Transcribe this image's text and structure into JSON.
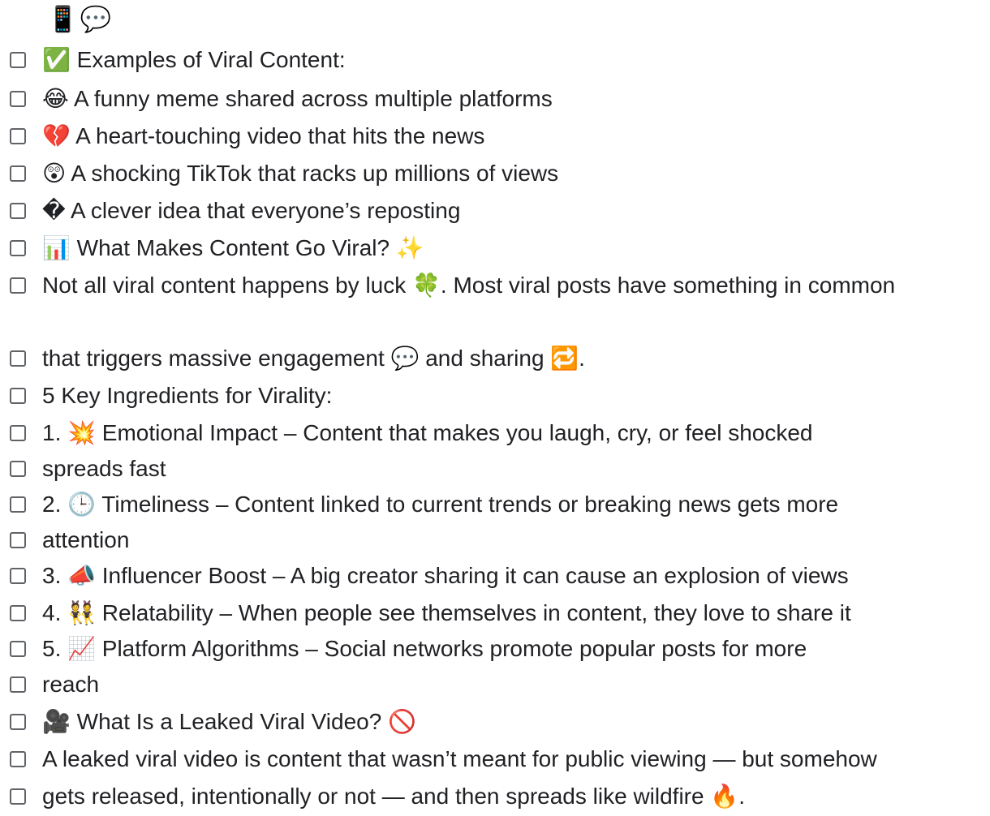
{
  "header_emoji": "📱💬",
  "items": [
    {
      "text": "✅ Examples of Viral Content:"
    },
    {
      "text": "😂 A funny meme shared across multiple platforms"
    },
    {
      "text": "💔 A heart-touching video that hits the news"
    },
    {
      "text": "😲 A shocking TikTok that racks up millions of views"
    },
    {
      "text": "� A clever idea that everyone’s reposting"
    },
    {
      "text": "📊 What Makes Content Go Viral? ✨"
    },
    {
      "text": "Not all viral content happens by luck 🍀. Most viral posts have something in common"
    },
    {
      "text": "that triggers massive engagement 💬 and sharing 🔁."
    },
    {
      "text": "5 Key Ingredients for Virality:"
    },
    {
      "text": "1. 💥 Emotional Impact – Content that makes you laugh, cry, or feel shocked"
    },
    {
      "text": "spreads fast"
    },
    {
      "text": "2. 🕒 Timeliness – Content linked to current trends or breaking news gets more"
    },
    {
      "text": "attention"
    },
    {
      "text": "3. 📣 Influencer Boost – A big creator sharing it can cause an explosion of views"
    },
    {
      "text": "4. 👯 Relatability – When people see themselves in content, they love to share it"
    },
    {
      "text": "5. 📈 Platform Algorithms – Social networks promote popular posts for more"
    },
    {
      "text": "reach"
    },
    {
      "text": "🎥 What Is a Leaked Viral Video? 🚫"
    },
    {
      "text": "A leaked viral video is content that wasn’t meant for public viewing — but somehow"
    },
    {
      "text": "gets released, intentionally or not — and then spreads like wildfire 🔥."
    }
  ]
}
